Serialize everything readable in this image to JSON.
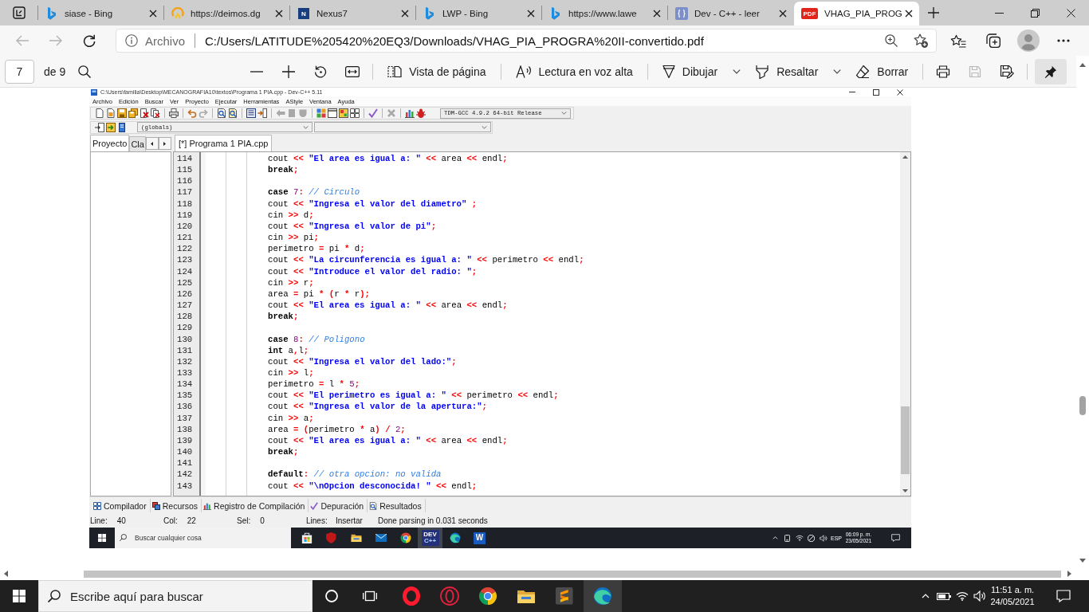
{
  "browser": {
    "tabs": [
      {
        "kind": "bing",
        "title": "siase - Bing",
        "selected": false
      },
      {
        "kind": "ring",
        "title": "https://deimos.dg",
        "selected": false
      },
      {
        "kind": "letter",
        "icon_text": "N",
        "title": "Nexus7",
        "selected": false
      },
      {
        "kind": "bing",
        "title": "LWP - Bing",
        "selected": false
      },
      {
        "kind": "bing",
        "title": "https://www.lawe",
        "selected": false
      },
      {
        "kind": "braces",
        "title": "Dev - C++ - leer",
        "selected": false
      },
      {
        "kind": "pdf",
        "icon_text": "PDF",
        "title": "VHAG_PIA_PROG",
        "selected": true
      }
    ],
    "navigation": [
      {
        "kind": "back",
        "disabled": true
      },
      {
        "kind": "forward",
        "disabled": true
      },
      {
        "kind": "refresh",
        "disabled": false
      }
    ],
    "address": {
      "scheme": "Archivo",
      "url": "C:/Users/LATITUDE%205420%20EQ3/Downloads/VHAG_PIA_PROGRA%20II-convertido.pdf"
    }
  },
  "pdf_toolbar": {
    "page": "7",
    "page_count": "de 9",
    "tools": [
      {
        "kind": "page_view",
        "label": "Vista de página",
        "dropdown": false
      },
      {
        "kind": "read_aloud",
        "label": "Lectura en voz alta",
        "dropdown": false
      },
      {
        "kind": "draw",
        "label": "Dibujar",
        "dropdown": true
      },
      {
        "kind": "highlight",
        "label": "Resaltar",
        "dropdown": true
      },
      {
        "kind": "erase",
        "label": "Borrar",
        "dropdown": false
      }
    ],
    "file_actions": [
      {
        "kind": "print",
        "disabled": false
      },
      {
        "kind": "save",
        "disabled": true
      },
      {
        "kind": "save_as",
        "disabled": false
      }
    ],
    "pin": {
      "selected": true
    }
  },
  "ide_window": {
    "title": "C:\\Users\\familia\\Desktop\\MECANOGRAFIA10\\textos\\Programa 1 PIA.cpp - Dev-C++ 5.11",
    "menu": [
      "Archivo",
      "Edición",
      "Buscar",
      "Ver",
      "Proyecto",
      "Ejecutar",
      "Herramientas",
      "AStyle",
      "Ventana",
      "Ayuda"
    ],
    "compiler": "TDM-GCC 4.9.2 64-bit Release",
    "scope": "(globals)",
    "side_tabs": [
      {
        "label": "Proyecto",
        "selected": true
      },
      {
        "label": "Cla",
        "selected": false
      }
    ],
    "editor_tabs": [
      {
        "label": "[*] Programa 1 PIA.cpp",
        "selected": true
      }
    ],
    "code_lines": [
      {
        "number": "114",
        "tokens": [
          {
            "kind": "plain",
            "text": "cout "
          },
          {
            "kind": "operator",
            "text": "<<"
          },
          {
            "kind": "string",
            "text": " \"El area es igual a: \""
          },
          {
            "kind": "operator",
            "text": " <<"
          },
          {
            "kind": "plain",
            "text": " area "
          },
          {
            "kind": "operator",
            "text": "<<"
          },
          {
            "kind": "plain",
            "text": " endl"
          },
          {
            "kind": "operator",
            "text": ";"
          }
        ]
      },
      {
        "number": "115",
        "tokens": [
          {
            "kind": "keyword",
            "text": "break"
          },
          {
            "kind": "operator",
            "text": ";"
          }
        ]
      },
      {
        "number": "116"
      },
      {
        "number": "117",
        "tokens": [
          {
            "kind": "keyword",
            "text": "case"
          },
          {
            "kind": "number",
            "text": " 7"
          },
          {
            "kind": "operator",
            "text": ":"
          },
          {
            "kind": "comment",
            "text": " // Circulo"
          }
        ]
      },
      {
        "number": "118",
        "tokens": [
          {
            "kind": "plain",
            "text": "cout "
          },
          {
            "kind": "operator",
            "text": "<<"
          },
          {
            "kind": "string",
            "text": " \"Ingresa el valor del diametro\""
          },
          {
            "kind": "operator",
            "text": " ;"
          }
        ]
      },
      {
        "number": "119",
        "tokens": [
          {
            "kind": "plain",
            "text": "cin "
          },
          {
            "kind": "operator",
            "text": ">>"
          },
          {
            "kind": "plain",
            "text": " d"
          },
          {
            "kind": "operator",
            "text": ";"
          }
        ]
      },
      {
        "number": "120",
        "tokens": [
          {
            "kind": "plain",
            "text": "cout "
          },
          {
            "kind": "operator",
            "text": "<<"
          },
          {
            "kind": "string",
            "text": " \"Ingresa el valor de pi\""
          },
          {
            "kind": "operator",
            "text": ";"
          }
        ]
      },
      {
        "number": "121",
        "tokens": [
          {
            "kind": "plain",
            "text": "cin "
          },
          {
            "kind": "operator",
            "text": ">>"
          },
          {
            "kind": "plain",
            "text": " pi"
          },
          {
            "kind": "operator",
            "text": ";"
          }
        ]
      },
      {
        "number": "122",
        "tokens": [
          {
            "kind": "plain",
            "text": "perimetro "
          },
          {
            "kind": "operator",
            "text": "="
          },
          {
            "kind": "plain",
            "text": " pi "
          },
          {
            "kind": "operator",
            "text": "*"
          },
          {
            "kind": "plain",
            "text": " d"
          },
          {
            "kind": "operator",
            "text": ";"
          }
        ]
      },
      {
        "number": "123",
        "tokens": [
          {
            "kind": "plain",
            "text": "cout "
          },
          {
            "kind": "operator",
            "text": "<<"
          },
          {
            "kind": "string",
            "text": " \"La circunferencia es igual a: \""
          },
          {
            "kind": "operator",
            "text": " <<"
          },
          {
            "kind": "plain",
            "text": " perimetro "
          },
          {
            "kind": "operator",
            "text": "<<"
          },
          {
            "kind": "plain",
            "text": " endl"
          },
          {
            "kind": "operator",
            "text": ";"
          }
        ]
      },
      {
        "number": "124",
        "tokens": [
          {
            "kind": "plain",
            "text": "cout "
          },
          {
            "kind": "operator",
            "text": "<<"
          },
          {
            "kind": "string",
            "text": " \"Introduce el valor del radio: \""
          },
          {
            "kind": "operator",
            "text": ";"
          }
        ]
      },
      {
        "number": "125",
        "tokens": [
          {
            "kind": "plain",
            "text": "cin "
          },
          {
            "kind": "operator",
            "text": ">>"
          },
          {
            "kind": "plain",
            "text": " r"
          },
          {
            "kind": "operator",
            "text": ";"
          }
        ]
      },
      {
        "number": "126",
        "tokens": [
          {
            "kind": "plain",
            "text": "area "
          },
          {
            "kind": "operator",
            "text": "="
          },
          {
            "kind": "plain",
            "text": " pi "
          },
          {
            "kind": "operator",
            "text": "*"
          },
          {
            "kind": "operator",
            "text": " ("
          },
          {
            "kind": "plain",
            "text": "r "
          },
          {
            "kind": "operator",
            "text": "*"
          },
          {
            "kind": "plain",
            "text": " r"
          },
          {
            "kind": "operator",
            "text": ");"
          }
        ]
      },
      {
        "number": "127",
        "tokens": [
          {
            "kind": "plain",
            "text": "cout "
          },
          {
            "kind": "operator",
            "text": "<<"
          },
          {
            "kind": "string",
            "text": " \"El area es igual a: \""
          },
          {
            "kind": "operator",
            "text": " <<"
          },
          {
            "kind": "plain",
            "text": " area "
          },
          {
            "kind": "operator",
            "text": "<<"
          },
          {
            "kind": "plain",
            "text": " endl"
          },
          {
            "kind": "operator",
            "text": ";"
          }
        ]
      },
      {
        "number": "128",
        "tokens": [
          {
            "kind": "keyword",
            "text": "break"
          },
          {
            "kind": "operator",
            "text": ";"
          }
        ]
      },
      {
        "number": "129"
      },
      {
        "number": "130",
        "tokens": [
          {
            "kind": "keyword",
            "text": "case"
          },
          {
            "kind": "number",
            "text": " 8"
          },
          {
            "kind": "operator",
            "text": ":"
          },
          {
            "kind": "comment",
            "text": " // Poligono"
          }
        ]
      },
      {
        "number": "131",
        "tokens": [
          {
            "kind": "keyword",
            "text": "int"
          },
          {
            "kind": "plain",
            "text": " a"
          },
          {
            "kind": "operator",
            "text": ","
          },
          {
            "kind": "plain",
            "text": "l"
          },
          {
            "kind": "operator",
            "text": ";"
          }
        ]
      },
      {
        "number": "132",
        "tokens": [
          {
            "kind": "plain",
            "text": "cout "
          },
          {
            "kind": "operator",
            "text": "<<"
          },
          {
            "kind": "string",
            "text": " \"Ingresa el valor del lado:\""
          },
          {
            "kind": "operator",
            "text": ";"
          }
        ]
      },
      {
        "number": "133",
        "tokens": [
          {
            "kind": "plain",
            "text": "cin "
          },
          {
            "kind": "operator",
            "text": ">>"
          },
          {
            "kind": "plain",
            "text": " l"
          },
          {
            "kind": "operator",
            "text": ";"
          }
        ]
      },
      {
        "number": "134",
        "tokens": [
          {
            "kind": "plain",
            "text": "perimetro "
          },
          {
            "kind": "operator",
            "text": "="
          },
          {
            "kind": "plain",
            "text": " l "
          },
          {
            "kind": "operator",
            "text": "*"
          },
          {
            "kind": "number",
            "text": " 5"
          },
          {
            "kind": "operator",
            "text": ";"
          }
        ]
      },
      {
        "number": "135",
        "tokens": [
          {
            "kind": "plain",
            "text": "cout "
          },
          {
            "kind": "operator",
            "text": "<<"
          },
          {
            "kind": "string",
            "text": " \"El perimetro es igual a: \""
          },
          {
            "kind": "operator",
            "text": " <<"
          },
          {
            "kind": "plain",
            "text": " perimetro "
          },
          {
            "kind": "operator",
            "text": "<<"
          },
          {
            "kind": "plain",
            "text": " endl"
          },
          {
            "kind": "operator",
            "text": ";"
          }
        ]
      },
      {
        "number": "136",
        "tokens": [
          {
            "kind": "plain",
            "text": "cout "
          },
          {
            "kind": "operator",
            "text": "<<"
          },
          {
            "kind": "string",
            "text": " \"Ingresa el valor de la apertura:\""
          },
          {
            "kind": "operator",
            "text": ";"
          }
        ]
      },
      {
        "number": "137",
        "tokens": [
          {
            "kind": "plain",
            "text": "cin "
          },
          {
            "kind": "operator",
            "text": ">>"
          },
          {
            "kind": "plain",
            "text": " a"
          },
          {
            "kind": "operator",
            "text": ";"
          }
        ]
      },
      {
        "number": "138",
        "tokens": [
          {
            "kind": "plain",
            "text": "area "
          },
          {
            "kind": "operator",
            "text": "="
          },
          {
            "kind": "operator",
            "text": " ("
          },
          {
            "kind": "plain",
            "text": "perimetro "
          },
          {
            "kind": "operator",
            "text": "*"
          },
          {
            "kind": "plain",
            "text": " a"
          },
          {
            "kind": "operator",
            "text": ")"
          },
          {
            "kind": "operator",
            "text": " /"
          },
          {
            "kind": "number",
            "text": " 2"
          },
          {
            "kind": "operator",
            "text": ";"
          }
        ]
      },
      {
        "number": "139",
        "tokens": [
          {
            "kind": "plain",
            "text": "cout "
          },
          {
            "kind": "operator",
            "text": "<<"
          },
          {
            "kind": "string",
            "text": " \"El area es igual a: \""
          },
          {
            "kind": "operator",
            "text": " <<"
          },
          {
            "kind": "plain",
            "text": " area "
          },
          {
            "kind": "operator",
            "text": "<<"
          },
          {
            "kind": "plain",
            "text": " endl"
          },
          {
            "kind": "operator",
            "text": ";"
          }
        ]
      },
      {
        "number": "140",
        "tokens": [
          {
            "kind": "keyword",
            "text": "break"
          },
          {
            "kind": "operator",
            "text": ";"
          }
        ]
      },
      {
        "number": "141"
      },
      {
        "number": "142",
        "tokens": [
          {
            "kind": "keyword",
            "text": "default"
          },
          {
            "kind": "operator",
            "text": ":"
          },
          {
            "kind": "comment",
            "text": " // otra opcion: no valida"
          }
        ]
      },
      {
        "number": "143",
        "tokens": [
          {
            "kind": "plain",
            "text": "cout "
          },
          {
            "kind": "operator",
            "text": "<<"
          },
          {
            "kind": "string",
            "text": " \"\\nOpcion desconocida! \""
          },
          {
            "kind": "operator",
            "text": " <<"
          },
          {
            "kind": "plain",
            "text": " endl"
          },
          {
            "kind": "operator",
            "text": ";"
          }
        ]
      }
    ],
    "bottom_tabs": [
      {
        "kind": "compiler",
        "label": "Compilador"
      },
      {
        "kind": "resources",
        "label": "Recursos"
      },
      {
        "kind": "log",
        "label": "Registro de Compilación"
      },
      {
        "kind": "debug",
        "label": "Depuración"
      },
      {
        "kind": "results",
        "label": "Resultados"
      }
    ],
    "status": [
      {
        "label": "Line:",
        "value": "40"
      },
      {
        "label": "Col:",
        "value": "22"
      },
      {
        "label": "Sel:",
        "value": "0"
      },
      {
        "label": "Lines:"
      },
      {
        "label": "Insertar"
      },
      {
        "label": "Done parsing in 0.031 seconds"
      }
    ],
    "taskbar": {
      "placeholder": "Buscar cualquier cosa",
      "apps": [
        {
          "kind": "store",
          "selected": false
        },
        {
          "kind": "shield",
          "selected": false
        },
        {
          "kind": "folder",
          "selected": false
        },
        {
          "kind": "mail",
          "selected": false
        },
        {
          "kind": "chrome",
          "selected": false
        },
        {
          "kind": "dev",
          "icon_text": "DEV",
          "icon_subtext": "C++",
          "selected": true
        },
        {
          "kind": "edge",
          "selected": false
        },
        {
          "kind": "word",
          "icon_text": "W",
          "selected": false
        }
      ],
      "language": "ESP",
      "time": "06:09 p. m.",
      "date": "23/05/2021"
    }
  },
  "taskbar": {
    "placeholder": "Escribe aquí para buscar",
    "apps": [
      {
        "kind": "cortana",
        "selected": false
      },
      {
        "kind": "taskview",
        "selected": false
      },
      {
        "kind": "opera",
        "selected": false
      },
      {
        "kind": "opera_gx",
        "selected": false
      },
      {
        "kind": "chrome",
        "selected": false
      },
      {
        "kind": "folder",
        "selected": false
      },
      {
        "kind": "sublime",
        "selected": false
      },
      {
        "kind": "edge",
        "selected": true
      }
    ],
    "time": "11:51 a. m.",
    "date": "24/05/2021"
  }
}
